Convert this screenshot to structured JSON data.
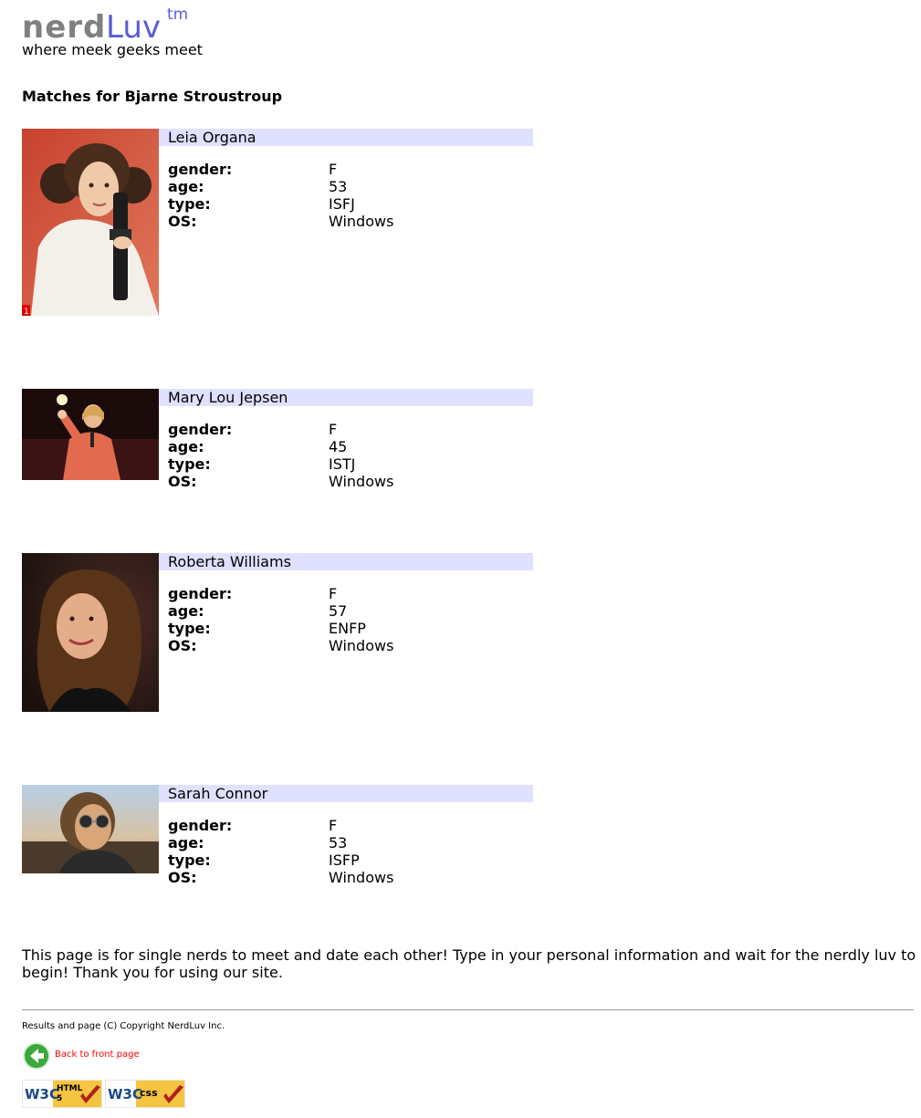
{
  "banner": {
    "logo_nerd": "nerd",
    "logo_luv": "Luv",
    "logo_tm": "tm",
    "tagline": "where meek geeks meet"
  },
  "heading": "Matches for Bjarne Stroustroup",
  "labels": {
    "gender": "gender:",
    "age": "age:",
    "type": "type:",
    "os": "OS:"
  },
  "matches": [
    {
      "name": "Leia Organa",
      "gender": "F",
      "age": "53",
      "type": "ISFJ",
      "os": "Windows",
      "photo_badge": "1"
    },
    {
      "name": "Mary Lou Jepsen",
      "gender": "F",
      "age": "45",
      "type": "ISTJ",
      "os": "Windows"
    },
    {
      "name": "Roberta Williams",
      "gender": "F",
      "age": "57",
      "type": "ENFP",
      "os": "Windows"
    },
    {
      "name": "Sarah Connor",
      "gender": "F",
      "age": "53",
      "type": "ISFP",
      "os": "Windows"
    }
  ],
  "blurb": "This page is for single nerds to meet and date each other! Type in your personal information and wait for the nerdly luv to begin! Thank you for using our site.",
  "footer": {
    "copyright": "Results and page (C) Copyright NerdLuv Inc.",
    "back_link": "Back to front page",
    "badge_html_w3c": "W3C",
    "badge_html_label": "HTML",
    "badge_html_version": "5",
    "badge_css_w3c": "W3C",
    "badge_css_label": "css"
  },
  "colors": {
    "logo_nerd": "#808080",
    "logo_luv": "#5b5bd9",
    "name_bar": "#e0e0ff",
    "back_link": "#ff0000",
    "back_icon": "#3aa83a",
    "badge": "#f5c542",
    "badge_check": "#b0201e"
  },
  "icons": {
    "back": "arrow-left-circle-icon",
    "check": "checkmark-icon"
  }
}
